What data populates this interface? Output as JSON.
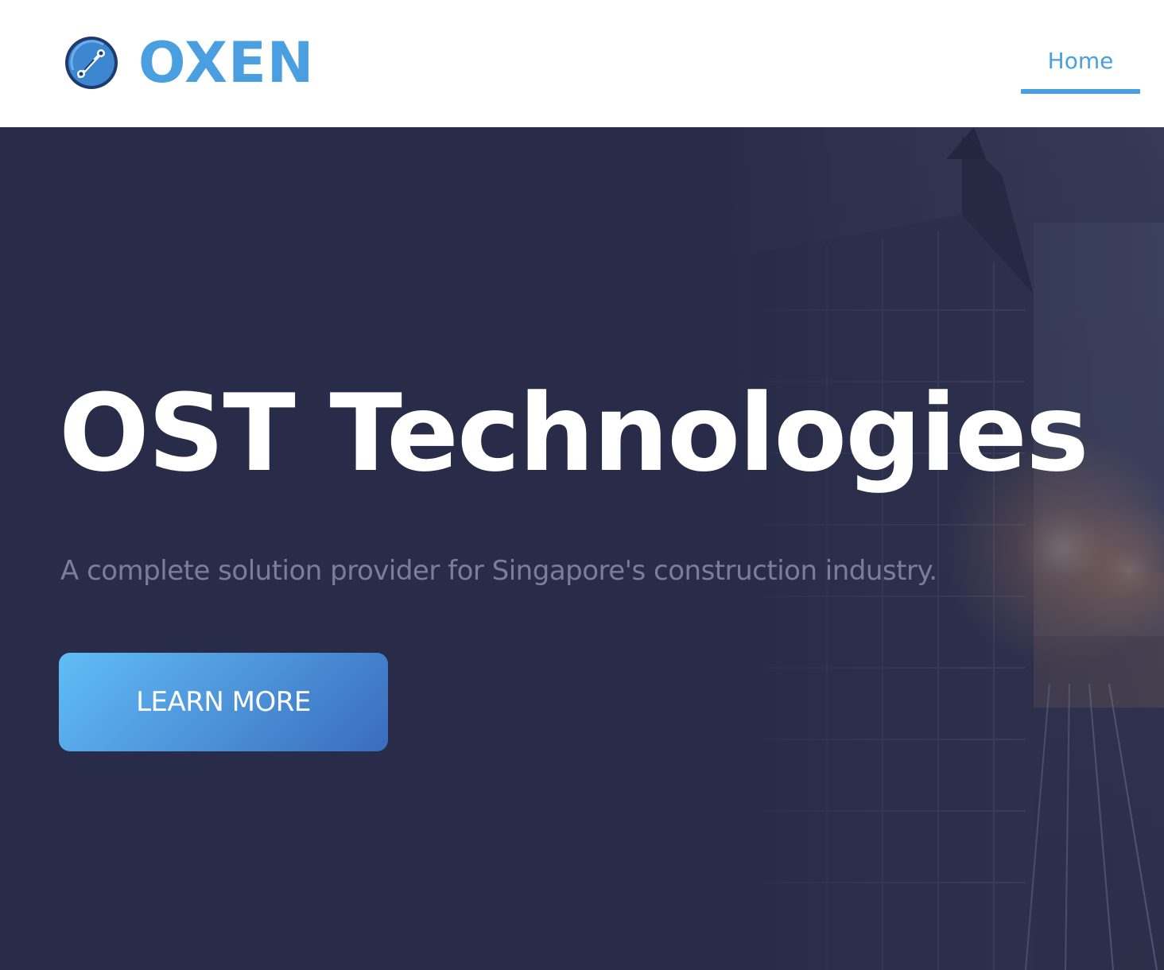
{
  "brand": {
    "name": "OXEN",
    "icon": "circuit-logo-icon",
    "color": "#4a9fe0"
  },
  "nav": {
    "items": [
      {
        "label": "Home",
        "active": true
      }
    ],
    "accent": "#4a9fe0"
  },
  "hero": {
    "title": "OST Technologies",
    "subtitle": "A complete solution provider for Singapore's construction industry.",
    "cta_label": "LEARN MORE",
    "background_color": "#282c48",
    "background_image": "construction-site-buildings-photo",
    "cta_gradient": [
      "#61bdf6",
      "#3a6cbe"
    ]
  }
}
